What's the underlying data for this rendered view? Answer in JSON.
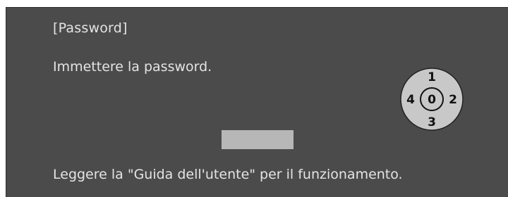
{
  "dialog": {
    "title": "[Password]",
    "prompt": "Immettere la password.",
    "footer": "Leggere la \"Guida dell'utente\" per il funzionamento."
  },
  "password_field": {
    "value": ""
  },
  "keypad": {
    "icon": "numeric-dial-icon",
    "up": "1",
    "right": "2",
    "down": "3",
    "left": "4",
    "center": "0"
  },
  "colors": {
    "background": "#4b4b4b",
    "text": "#e4e4e4",
    "field": "#b7b7b7",
    "dial_fill": "#c8c8c8",
    "dial_ink": "#111111"
  }
}
